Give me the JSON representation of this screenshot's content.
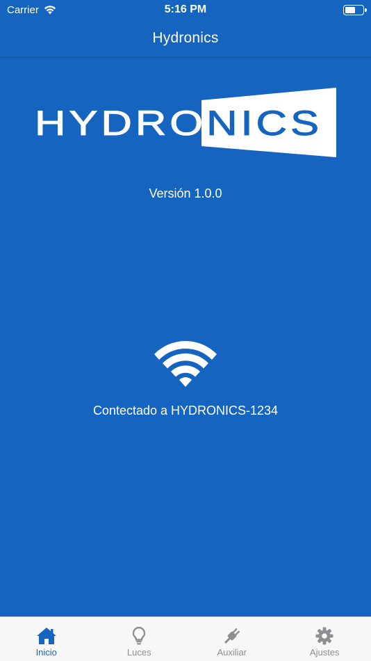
{
  "status": {
    "carrier": "Carrier",
    "time": "5:16 PM",
    "battery_level": 0.6
  },
  "nav": {
    "title": "Hydronics"
  },
  "main": {
    "logo_text": "HYDRONICS",
    "version": "Versión 1.0.0",
    "connection_icon": "wifi-icon",
    "connection_text": "Contectado a HYDRONICS-1234"
  },
  "tabs": [
    {
      "label": "Inicio",
      "icon": "home-icon",
      "active": true
    },
    {
      "label": "Luces",
      "icon": "lightbulb-icon",
      "active": false
    },
    {
      "label": "Auxiliar",
      "icon": "plug-icon",
      "active": false
    },
    {
      "label": "Ajustes",
      "icon": "gear-icon",
      "active": false
    }
  ],
  "colors": {
    "background": "#1565c0",
    "tab_active": "#1565c0",
    "tab_inactive": "#8e8e93"
  }
}
